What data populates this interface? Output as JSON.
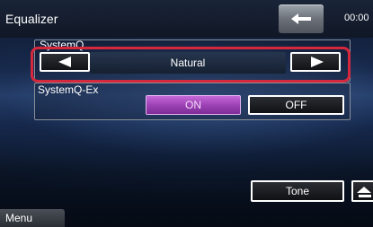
{
  "header": {
    "title": "Equalizer",
    "clock": "00:00",
    "back_icon": "back-arrow-icon"
  },
  "system_q": {
    "label": "SystemQ",
    "value": "Natural",
    "prev_icon": "left-triangle-icon",
    "next_icon": "right-triangle-icon"
  },
  "system_q_ex": {
    "label": "SystemQ-Ex",
    "on_label": "ON",
    "off_label": "OFF",
    "selected": "ON"
  },
  "buttons": {
    "tone_label": "Tone"
  },
  "footer": {
    "menu_label": "Menu"
  },
  "colors": {
    "highlight": "#d6283d",
    "on_accent": "#b04fca"
  }
}
